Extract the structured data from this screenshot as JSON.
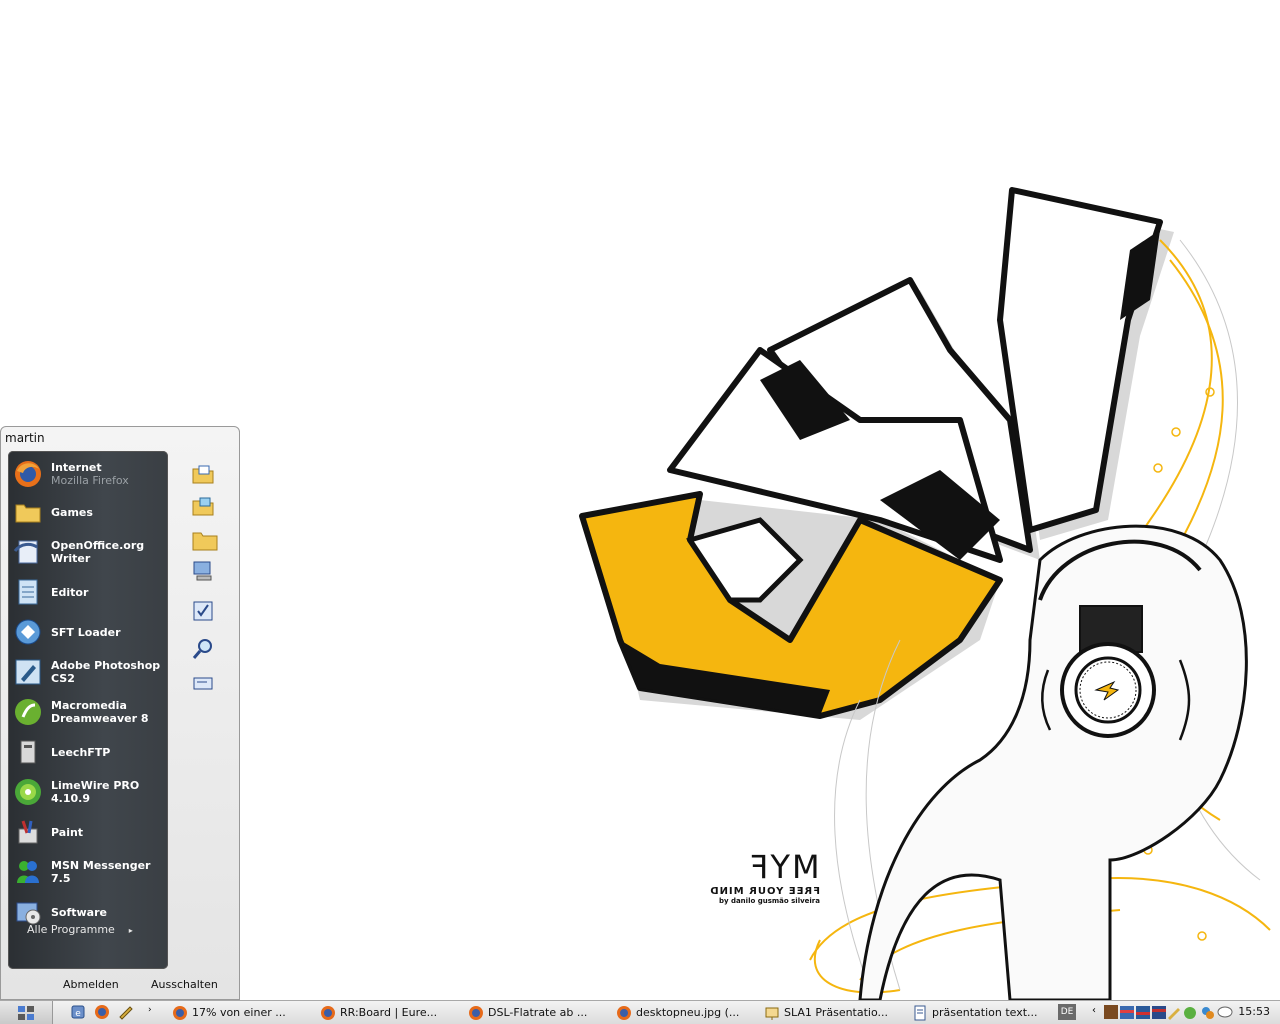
{
  "start_menu": {
    "user": "martin",
    "programs": [
      {
        "label": "Internet",
        "sub": "Mozilla Firefox",
        "icon": "firefox-icon"
      },
      {
        "label": "Games",
        "sub": "",
        "icon": "folder-icon"
      },
      {
        "label": "OpenOffice.org Writer",
        "sub": "",
        "icon": "openoffice-writer-icon"
      },
      {
        "label": "Editor",
        "sub": "",
        "icon": "notepad-icon"
      },
      {
        "label": "SFT Loader",
        "sub": "",
        "icon": "sft-loader-icon"
      },
      {
        "label": "Adobe Photoshop CS2",
        "sub": "",
        "icon": "photoshop-icon"
      },
      {
        "label": "Macromedia Dreamweaver 8",
        "sub": "",
        "icon": "dreamweaver-icon"
      },
      {
        "label": "LeechFTP",
        "sub": "",
        "icon": "leechftp-icon"
      },
      {
        "label": "LimeWire PRO 4.10.9",
        "sub": "",
        "icon": "limewire-icon"
      },
      {
        "label": "Paint",
        "sub": "",
        "icon": "paint-icon"
      },
      {
        "label": "MSN Messenger 7.5",
        "sub": "",
        "icon": "msn-messenger-icon"
      },
      {
        "label": "Software",
        "sub": "",
        "icon": "software-icon"
      }
    ],
    "all_programs": "Alle Programme",
    "right_icons": [
      "documents-folder-icon",
      "pictures-folder-icon",
      "folder-icon",
      "my-computer-icon",
      "control-panel-icon",
      "search-icon",
      "run-icon"
    ],
    "logoff": "Abmelden",
    "shutdown": "Ausschalten"
  },
  "wallpaper": {
    "title": "MYF",
    "subtitle": "FREE YOUR MIND",
    "credit": "by danilo gusmão silveira"
  },
  "taskbar": {
    "tasks": [
      {
        "label": "17% von einer ...",
        "icon": "firefox-icon"
      },
      {
        "label": "RR:Board | Eure...",
        "icon": "firefox-icon"
      },
      {
        "label": "DSL-Flatrate ab ...",
        "icon": "firefox-icon"
      },
      {
        "label": "desktopneu.jpg (...",
        "icon": "firefox-icon"
      },
      {
        "label": "SLA1 Präsentatio...",
        "icon": "presentation-icon"
      },
      {
        "label": "präsentation text...",
        "icon": "document-icon"
      }
    ],
    "language": "DE",
    "clock": "15:53"
  }
}
